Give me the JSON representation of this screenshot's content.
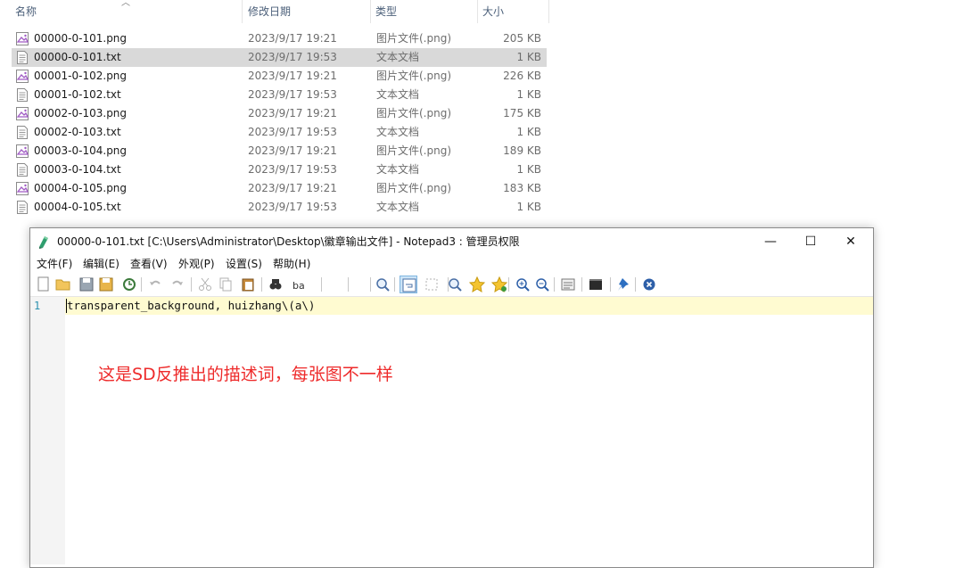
{
  "explorer": {
    "columns": {
      "name": "名称",
      "date": "修改日期",
      "type": "类型",
      "size": "大小"
    },
    "files": [
      {
        "name": "00000-0-101.png",
        "date": "2023/9/17 19:21",
        "type": "图片文件(.png)",
        "size": "205 KB",
        "kind": "png"
      },
      {
        "name": "00000-0-101.txt",
        "date": "2023/9/17 19:53",
        "type": "文本文档",
        "size": "1 KB",
        "kind": "txt",
        "selected": true
      },
      {
        "name": "00001-0-102.png",
        "date": "2023/9/17 19:21",
        "type": "图片文件(.png)",
        "size": "226 KB",
        "kind": "png"
      },
      {
        "name": "00001-0-102.txt",
        "date": "2023/9/17 19:53",
        "type": "文本文档",
        "size": "1 KB",
        "kind": "txt"
      },
      {
        "name": "00002-0-103.png",
        "date": "2023/9/17 19:21",
        "type": "图片文件(.png)",
        "size": "175 KB",
        "kind": "png"
      },
      {
        "name": "00002-0-103.txt",
        "date": "2023/9/17 19:53",
        "type": "文本文档",
        "size": "1 KB",
        "kind": "txt"
      },
      {
        "name": "00003-0-104.png",
        "date": "2023/9/17 19:21",
        "type": "图片文件(.png)",
        "size": "189 KB",
        "kind": "png"
      },
      {
        "name": "00003-0-104.txt",
        "date": "2023/9/17 19:53",
        "type": "文本文档",
        "size": "1 KB",
        "kind": "txt"
      },
      {
        "name": "00004-0-105.png",
        "date": "2023/9/17 19:21",
        "type": "图片文件(.png)",
        "size": "183 KB",
        "kind": "png"
      },
      {
        "name": "00004-0-105.txt",
        "date": "2023/9/17 19:53",
        "type": "文本文档",
        "size": "1 KB",
        "kind": "txt"
      }
    ]
  },
  "notepad": {
    "title": "00000-0-101.txt [C:\\Users\\Administrator\\Desktop\\徽章输出文件] - Notepad3 : 管理员权限",
    "window_buttons": {
      "minimize": "—",
      "maximize": "☐",
      "close": "✕"
    },
    "menu": [
      "文件(F)",
      "编辑(E)",
      "查看(V)",
      "外观(P)",
      "设置(S)",
      "帮助(H)"
    ],
    "toolbar_icons": [
      "new-file-icon",
      "open-folder-icon",
      "save-icon",
      "save-as-icon",
      "reload-icon",
      "undo-icon",
      "redo-icon",
      "cut-icon",
      "copy-icon",
      "paste-icon",
      "find-icon",
      "replace-icon",
      "find-in-files-icon",
      "word-wrap-icon",
      "select-all-icon",
      "zoom-search-icon",
      "bookmark-icon",
      "bookmark-next-icon",
      "zoom-in-icon",
      "zoom-out-icon",
      "schema-icon",
      "console-icon",
      "pin-icon",
      "exit-icon"
    ],
    "line_number": "1",
    "content": "transparent_background, huizhang\\(a\\)"
  },
  "annotation": "这是SD反推出的描述词，每张图不一样",
  "colors": {
    "annotation": "#ee2b2b",
    "selected_row": "#d9d9d9",
    "current_line": "#fffbd1",
    "png_icon": "#a05bc4"
  }
}
